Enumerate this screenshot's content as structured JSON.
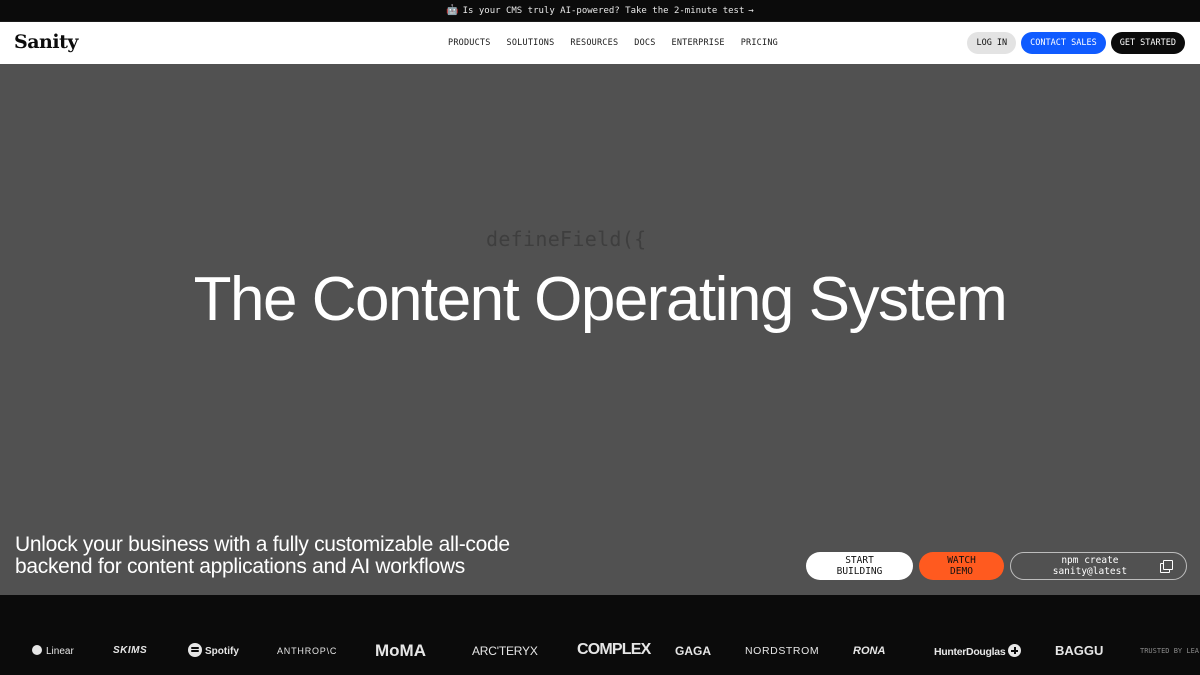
{
  "announcement": {
    "icon": "robot-icon",
    "text": "Is your CMS truly AI-powered? Take the 2-minute test",
    "arrow": "→"
  },
  "nav": {
    "logo": "Sanity",
    "menu": [
      "PRODUCTS",
      "SOLUTIONS",
      "RESOURCES",
      "DOCS",
      "ENTERPRISE",
      "PRICING"
    ],
    "login": "LOG IN",
    "contact_sales": "CONTACT SALES",
    "get_started": "GET STARTED"
  },
  "hero": {
    "code": "defineField({",
    "headline": "The Content Operating System",
    "subheading_line1": "Unlock your business with a fully customizable all-code",
    "subheading_line2": "backend for content applications and AI workflows",
    "start_building": "START BUILDING",
    "watch_demo": "WATCH DEMO",
    "npm_command": "npm create sanity@latest"
  },
  "logos": {
    "items": [
      "Linear",
      "SKIMS",
      "Spotify",
      "ANTHROP\\C",
      "MoMA",
      "ARC'TERYX",
      "COMPLEX",
      "GAGA",
      "NORDSTROM",
      "RONA",
      "HunterDouglas",
      "BAGGU"
    ],
    "trusted": "TRUSTED BY LEA"
  },
  "colors": {
    "hero_bg": "#515151",
    "accent_blue": "#0f5bff",
    "accent_orange": "#ff5a1f",
    "dark": "#0b0b0b"
  }
}
